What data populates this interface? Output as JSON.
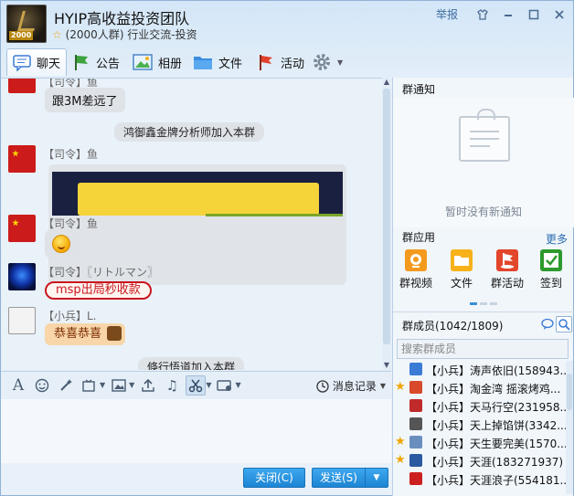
{
  "header": {
    "badge": "2000",
    "title": "HYIP高收益投资团队",
    "subtitle": "(2000人群) 行业交流-投资",
    "report": "举报"
  },
  "tabs": [
    {
      "label": "聊天",
      "icon": "chat-icon",
      "active": true
    },
    {
      "label": "公告",
      "icon": "flag-icon"
    },
    {
      "label": "相册",
      "icon": "photo-icon"
    },
    {
      "label": "文件",
      "icon": "folder-icon"
    },
    {
      "label": "活动",
      "icon": "activity-flag-icon"
    }
  ],
  "chat": {
    "msg0_sender": "【司令】鱼",
    "msg0_text": "跟3M差远了",
    "sys1": "鸿御鑫金牌分析师加入本群",
    "msg1_sender": "【司令】鱼",
    "msg2_sender": "【司令】鱼",
    "msg3_sender": "【司令】〖リトルマン〗",
    "msg3_text": "msp出局秒收款",
    "msg4_sender": "【小兵】L.",
    "msg4_text": "恭喜恭喜",
    "sys2": "倏行悟道加入本群"
  },
  "toolbar": {
    "history": "消息记录"
  },
  "buttons": {
    "close": "关闭(C)",
    "send": "发送(S)"
  },
  "right": {
    "notice_title": "群通知",
    "notice_empty": "暂时没有新通知",
    "apps_title": "群应用",
    "more": "更多",
    "apps": [
      {
        "label": "群视频",
        "color": "#f39a1e"
      },
      {
        "label": "文件",
        "color": "#f7b21a"
      },
      {
        "label": "群活动",
        "color": "#e2462b"
      },
      {
        "label": "签到",
        "color": "#2c9a2c"
      }
    ],
    "members_title": "群成员(1042/1809)",
    "members_search_placeholder": "搜索群成员",
    "members": [
      {
        "name": "【小兵】涛声依旧(158943...",
        "star": false,
        "color": "#3a7bd5"
      },
      {
        "name": "【小兵】淘金湾 摇滚烤鸡...",
        "star": true,
        "color": "#d84a2b"
      },
      {
        "name": "【小兵】天马行空(231958...",
        "star": false,
        "color": "#c12a2a"
      },
      {
        "name": "【小兵】天上掉馅饼(3342...",
        "star": false,
        "color": "#555555"
      },
      {
        "name": "【小兵】天生要完美(1570...",
        "star": true,
        "color": "#6a8fbf"
      },
      {
        "name": "【小兵】天涯(183271937)",
        "star": true,
        "color": "#2b5aa0"
      },
      {
        "name": "【小兵】天涯浪子(554181...",
        "star": false,
        "color": "#cc2020"
      }
    ]
  }
}
